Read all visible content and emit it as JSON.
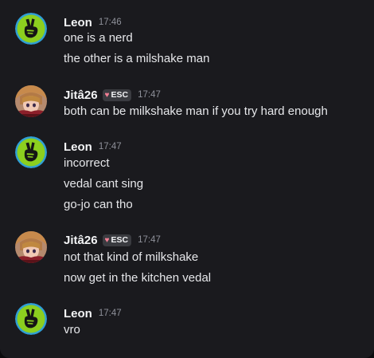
{
  "colors": {
    "background": "#1a1a1e",
    "leon_avatar_ring": "#2f9fd6",
    "leon_avatar_fill": "#8ccf1f",
    "tag_heart": "#f47f95"
  },
  "messages": [
    {
      "username": "Leon",
      "avatar_icon": "peace-sign-hand-icon",
      "timestamp": "17:46",
      "lines": [
        "one is a nerd",
        "the other is a milshake man"
      ]
    },
    {
      "username": "Jitâ26",
      "avatar_icon": "anime-character-avatar",
      "tag": "ESC",
      "tag_icon": "heart-icon",
      "timestamp": "17:47",
      "lines": [
        "both can be milkshake man if you try hard enough"
      ]
    },
    {
      "username": "Leon",
      "avatar_icon": "peace-sign-hand-icon",
      "timestamp": "17:47",
      "lines": [
        "incorrect",
        "vedal cant sing",
        "go-jo can tho"
      ]
    },
    {
      "username": "Jitâ26",
      "avatar_icon": "anime-character-avatar",
      "tag": "ESC",
      "tag_icon": "heart-icon",
      "timestamp": "17:47",
      "lines": [
        "not that kind of milkshake",
        "now get in the kitchen vedal"
      ]
    },
    {
      "username": "Leon",
      "avatar_icon": "peace-sign-hand-icon",
      "timestamp": "17:47",
      "lines": [
        "vro"
      ]
    }
  ]
}
